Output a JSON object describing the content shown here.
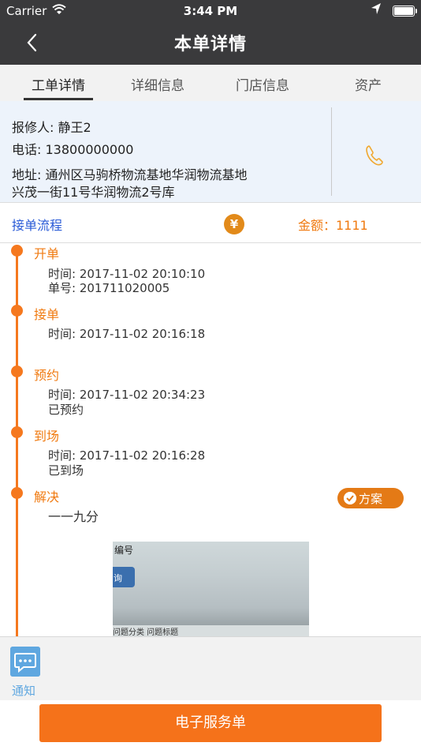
{
  "status_bar": {
    "carrier": "Carrier",
    "time": "3:44 PM"
  },
  "nav": {
    "title": "本单详情"
  },
  "tabs": [
    {
      "label": "工单详情",
      "active": true
    },
    {
      "label": "详细信息",
      "active": false
    },
    {
      "label": "门店信息",
      "active": false
    },
    {
      "label": "资产",
      "active": false
    }
  ],
  "info": {
    "reporter": "报修人: 静王2",
    "phone": "电话: 13800000000",
    "address_line1": "地址: 通州区马驹桥物流基地华润物流基地",
    "address_line2": "兴茂一街11号华润物流2号库"
  },
  "flow": {
    "label": "接单流程",
    "amount": "金额：1111"
  },
  "steps": [
    {
      "title": "开单",
      "lines": [
        "时间: 2017-11-02 20:10:10",
        "单号: 201711020005"
      ]
    },
    {
      "title": "接单",
      "lines": [
        "时间: 2017-11-02 20:16:18"
      ]
    },
    {
      "title": "预约",
      "lines": [
        "时间: 2017-11-02 20:34:23",
        "已预约"
      ]
    },
    {
      "title": "到场",
      "lines": [
        "时间: 2017-11-02 20:16:28",
        "已到场"
      ]
    },
    {
      "title": "解决",
      "lines": [
        "一一九分"
      ]
    }
  ],
  "plan_button": "方案",
  "photo_text": {
    "label1": "编号",
    "label2": "询",
    "bottom": "问题分类   问题标题"
  },
  "footer": {
    "notice_label": "通知",
    "service_button": "电子服务单"
  },
  "colors": {
    "accent": "#f5781e",
    "header": "#3a3a3c",
    "link": "#2a5bd7"
  }
}
